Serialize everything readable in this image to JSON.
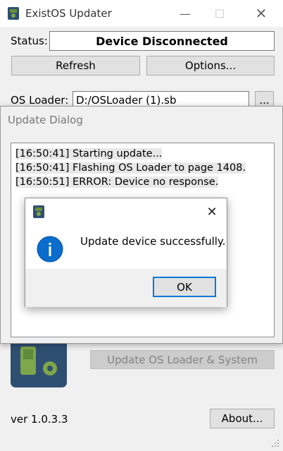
{
  "window": {
    "title": "ExistOS Updater"
  },
  "status": {
    "label": "Status:",
    "value": "Device Disconnected"
  },
  "buttons": {
    "refresh": "Refresh",
    "options": "Options...",
    "browse": "...",
    "update": "Update OS Loader & System",
    "about": "About..."
  },
  "os_loader": {
    "label": "OS Loader:",
    "path": "D:/OSLoader (1).sb"
  },
  "version": "ver 1.0.3.3",
  "update_dialog": {
    "title": "Update Dialog",
    "log": [
      "[16:50:41] Starting update...",
      "[16:50:41] Flashing OS Loader to page 1408.",
      "[16:50:51] ERROR: Device no response."
    ]
  },
  "message_box": {
    "text": "Update device successfully.",
    "ok": "OK"
  },
  "colors": {
    "accent": "#0078d7",
    "info_icon": "#0a6ccb",
    "device": "#2f4f72"
  },
  "icons": {
    "app": "calculator-app-icon",
    "info": "info-icon",
    "close": "close-icon",
    "minimize": "minimize-icon",
    "maximize": "maximize-icon"
  }
}
